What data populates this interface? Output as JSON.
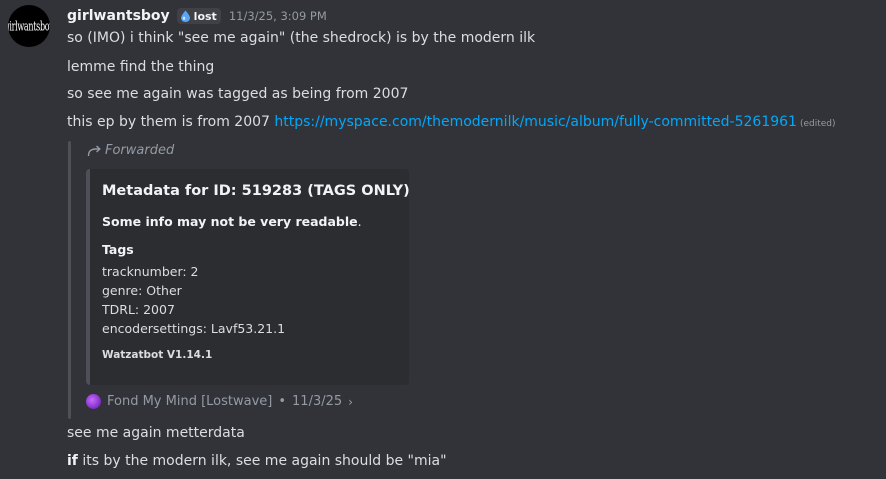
{
  "author": {
    "avatar_logo": "[girlwantsboy]",
    "username": "girlwantsboy",
    "tag_label": "lost",
    "timestamp": "11/3/25, 3:09 PM"
  },
  "messages": [
    "so (IMO) i think \"see me again\" (the shedrock) is by the modern ilk",
    "lemme find the thing",
    "so see me again was tagged as being from 2007"
  ],
  "message_link": {
    "prefix": "this ep by them is from 2007 ",
    "url": "https://myspace.com/themodernilk/music/album/fully-committed-5261961",
    "edited": "(edited)"
  },
  "forward": {
    "label": "Forwarded",
    "embed": {
      "title": "Metadata for ID: 519283 (TAGS ONLY)",
      "description": "Some info may not be very readable",
      "description_end": ".",
      "field_name": "Tags",
      "field_lines": [
        "tracknumber: 2",
        "genre: Other",
        "TDRL: 2007",
        "encodersettings: Lavf53.21.1"
      ],
      "footer": "Watzatbot V1.14.1"
    },
    "source": {
      "server": "Fond My Mind [Lostwave]",
      "separator": "•",
      "date": "11/3/25",
      "chevron": "›"
    }
  },
  "followups": {
    "line1": "see me again metterdata",
    "line2_bold": "if",
    "line2_rest": " its by the modern ilk, see me again should be \"mia\""
  },
  "colors": {
    "background": "#313338",
    "link": "#00a8fc",
    "embed_bg": "#2b2d31",
    "muted": "#949ba4"
  }
}
